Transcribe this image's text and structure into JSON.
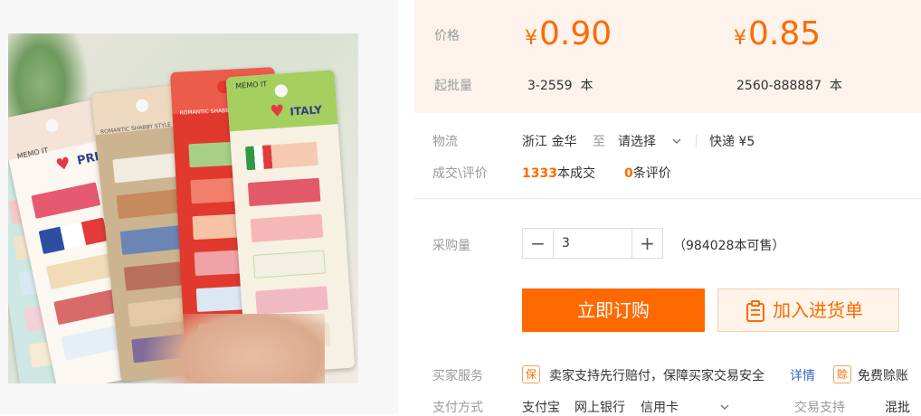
{
  "product_image": {
    "cards": [
      {
        "brand": "MEMO IT",
        "label": "PRI"
      },
      {
        "brand": "ROMANTIC SHABBY STYLE",
        "label": ""
      },
      {
        "brand": "ROMANTIC SHABBY STYLE",
        "label": ""
      },
      {
        "brand": "MEMO IT",
        "label": "ITALY"
      }
    ]
  },
  "price": {
    "label": "价格",
    "currency": "¥",
    "tier1": "0.90",
    "tier2": "0.85",
    "moq_label": "起批量",
    "range1": "3-2559",
    "range2": "2560-888887",
    "unit": "本"
  },
  "logistics": {
    "label": "物流",
    "origin": "浙江 金华",
    "to": "至",
    "select": "请选择",
    "method": "快递",
    "fee": "¥5"
  },
  "trade": {
    "label": "成交\\评价",
    "deals_count": "1333",
    "deals_text": "本成交",
    "reviews_count": "0",
    "reviews_text": "条评价"
  },
  "quantity": {
    "label": "采购量",
    "value": "3",
    "available": "（984028本可售）"
  },
  "actions": {
    "buy_now": "立即订购",
    "add_to_cart": "加入进货单"
  },
  "services": {
    "label": "买家服务",
    "badge1": "保",
    "text1": "卖家支持先行赔付，保障买家交易安全",
    "details": "详情",
    "badge2": "赊",
    "text2": "免费赊账"
  },
  "payment": {
    "label": "支付方式",
    "methods": [
      "支付宝",
      "网上银行",
      "信用卡"
    ],
    "trade_support_label": "交易支持",
    "trade_support_value": "混批"
  },
  "colors": {
    "accent": "#ff6a00",
    "price_bg": "#fdf3ec",
    "link": "#3366cc"
  }
}
